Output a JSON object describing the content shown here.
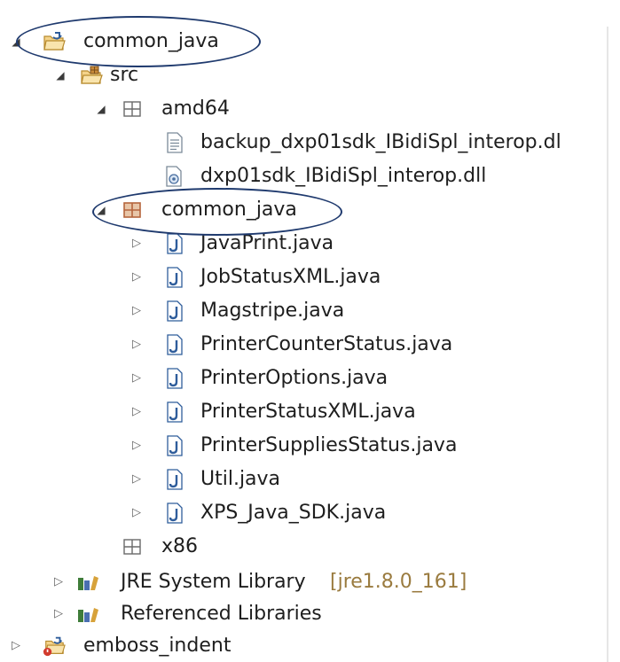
{
  "tree": {
    "project": {
      "label": "common_java",
      "src": {
        "label": "src",
        "packages": [
          {
            "label": "amd64",
            "files": [
              {
                "label": "backup_dxp01sdk_IBidiSpl_interop.dl",
                "icon": "text-file-icon"
              },
              {
                "label": "dxp01sdk_IBidiSpl_interop.dll",
                "icon": "dll-file-icon"
              }
            ]
          },
          {
            "label": "common_java",
            "files": [
              {
                "label": "JavaPrint.java",
                "icon": "java-file-icon"
              },
              {
                "label": "JobStatusXML.java",
                "icon": "java-file-icon"
              },
              {
                "label": "Magstripe.java",
                "icon": "java-file-icon"
              },
              {
                "label": "PrinterCounterStatus.java",
                "icon": "java-file-icon"
              },
              {
                "label": "PrinterOptions.java",
                "icon": "java-file-icon"
              },
              {
                "label": "PrinterStatusXML.java",
                "icon": "java-file-icon"
              },
              {
                "label": "PrinterSuppliesStatus.java",
                "icon": "java-file-icon"
              },
              {
                "label": "Util.java",
                "icon": "java-file-icon"
              },
              {
                "label": "XPS_Java_SDK.java",
                "icon": "java-file-icon"
              }
            ]
          },
          {
            "label": "x86"
          }
        ]
      },
      "libraries": [
        {
          "label": "JRE System Library",
          "decoration": "[jre1.8.0_161]"
        },
        {
          "label": "Referenced Libraries",
          "decoration": ""
        }
      ]
    },
    "other_project": {
      "label": "emboss_indent"
    }
  },
  "colors": {
    "annotation_circle": "#1f3a6e",
    "java_icon": "#2f5d9b",
    "folder": "#e0b34a",
    "package_selected": "#b5653d",
    "decoration_text": "#9a7b3f"
  }
}
